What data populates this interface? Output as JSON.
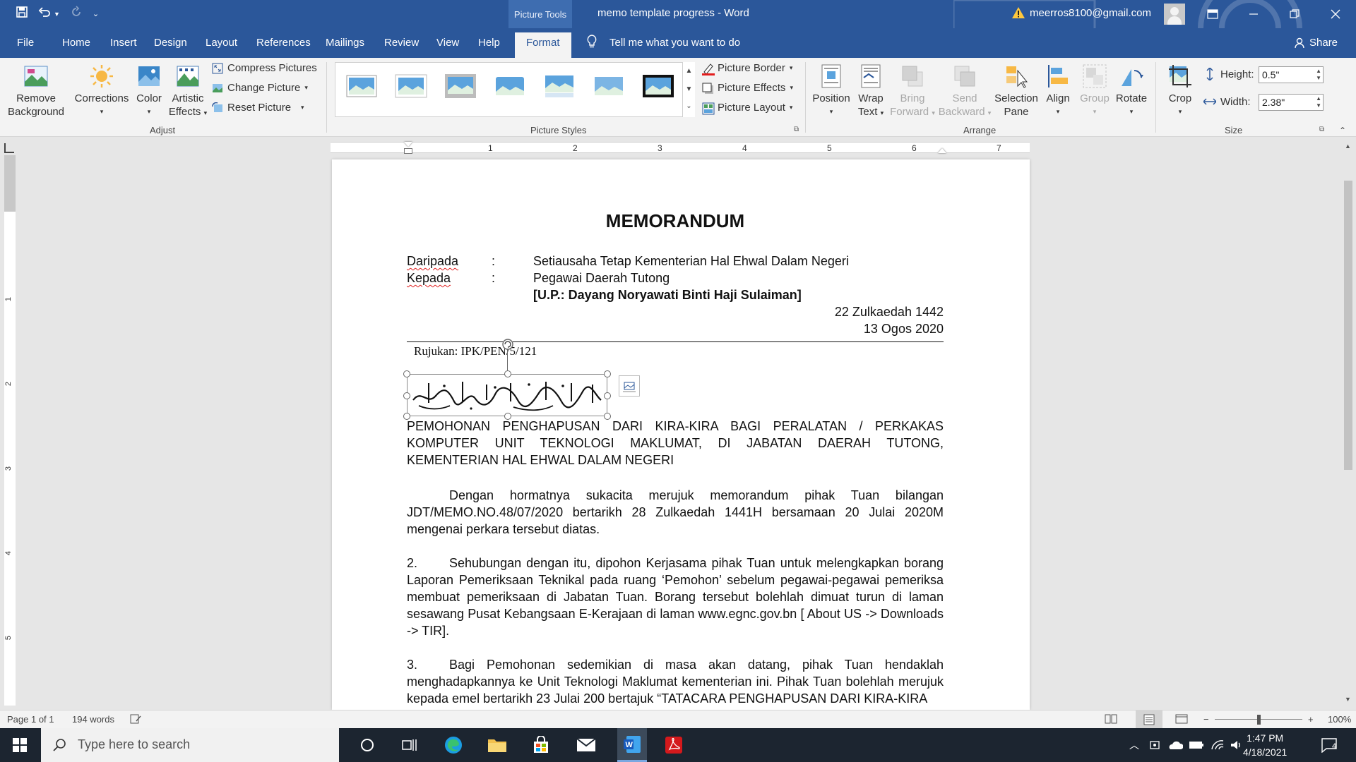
{
  "window": {
    "contextual_tab": "Picture Tools",
    "title": "memo template progress  -  Word",
    "account": "meerros8100@gmail.com"
  },
  "tabs": [
    "File",
    "Home",
    "Insert",
    "Design",
    "Layout",
    "References",
    "Mailings",
    "Review",
    "View",
    "Help",
    "Format"
  ],
  "active_tab": "Format",
  "tell_me": "Tell me what you want to do",
  "share": "Share",
  "ribbon": {
    "adjust": {
      "remove_background": [
        "Remove",
        "Background"
      ],
      "corrections": "Corrections",
      "color": "Color",
      "artistic": [
        "Artistic",
        "Effects"
      ],
      "compress": "Compress Pictures",
      "change": "Change Picture",
      "reset": "Reset Picture",
      "label": "Adjust"
    },
    "picture_styles": {
      "border": "Picture Border",
      "effects": "Picture Effects",
      "layout": "Picture Layout",
      "label": "Picture Styles"
    },
    "arrange": {
      "position": "Position",
      "wrap": [
        "Wrap",
        "Text"
      ],
      "bring": [
        "Bring",
        "Forward"
      ],
      "send": [
        "Send",
        "Backward"
      ],
      "selection": [
        "Selection",
        "Pane"
      ],
      "align": "Align",
      "group": "Group",
      "rotate": "Rotate",
      "label": "Arrange"
    },
    "size": {
      "crop": "Crop",
      "height_label": "Height:",
      "height_value": "0.5\"",
      "width_label": "Width:",
      "width_value": "2.38\"",
      "label": "Size"
    }
  },
  "ruler": [
    "1",
    "2",
    "3",
    "4",
    "5",
    "6",
    "7"
  ],
  "vruler": [
    "1",
    "2",
    "3",
    "4",
    "5"
  ],
  "document": {
    "heading": "MEMORANDUM",
    "from_label": "Daripada",
    "colon": ":",
    "from_value": "Setiausaha Tetap Kementerian Hal Ehwal Dalam Negeri",
    "to_label": "Kepada",
    "to_value": "Pegawai Daerah Tutong",
    "attention": "[U.P.: Dayang Noryawati Binti Haji Sulaiman]",
    "date_hijri": "22 Zulkaedah 1442",
    "date_greg": "13 Ogos 2020",
    "reference": "Rujukan: IPK/PEN/5/121",
    "subject": "PEMOHONAN PENGHAPUSAN DARI KIRA-KIRA BAGI PERALATAN / PERKAKAS KOMPUTER UNIT TEKNOLOGI MAKLUMAT, DI JABATAN DAERAH TUTONG, KEMENTERIAN HAL EHWAL DALAM NEGERI",
    "para1": "Dengan hormatnya sukacita merujuk memorandum pihak Tuan bilangan JDT/MEMO.NO.48/07/2020 bertarikh 28 Zulkaedah 1441H bersamaan 20 Julai 2020M mengenai perkara tersebut diatas.",
    "para2_num": "2.",
    "para2": "Sehubungan dengan itu, dipohon Kerjasama pihak Tuan untuk melengkapkan borang Laporan Pemeriksaan Teknikal pada ruang ‘Pemohon’ sebelum pegawai-pegawai pemeriksa membuat pemeriksaan di Jabatan Tuan. Borang tersebut bolehlah dimuat turun di laman sesawang Pusat Kebangsaan E-Kerajaan di laman www.egnc.gov.bn [ About US -> Downloads -> TIR].",
    "para3_num": "3.",
    "para3": "Bagi Pemohonan sedemikian di masa akan datang, pihak Tuan hendaklah menghadapkannya ke Unit Teknologi Maklumat kementerian ini. Pihak Tuan bolehlah merujuk kepada emel bertarikh 23 Julai 200 bertajuk “TATACARA PENGHAPUSAN DARI KIRA-KIRA"
  },
  "status": {
    "page": "Page 1 of 1",
    "words": "194 words",
    "zoom": "100%"
  },
  "taskbar": {
    "search": "Type here to search",
    "time": "1:47 PM",
    "date": "4/18/2021",
    "notifications": "4"
  }
}
